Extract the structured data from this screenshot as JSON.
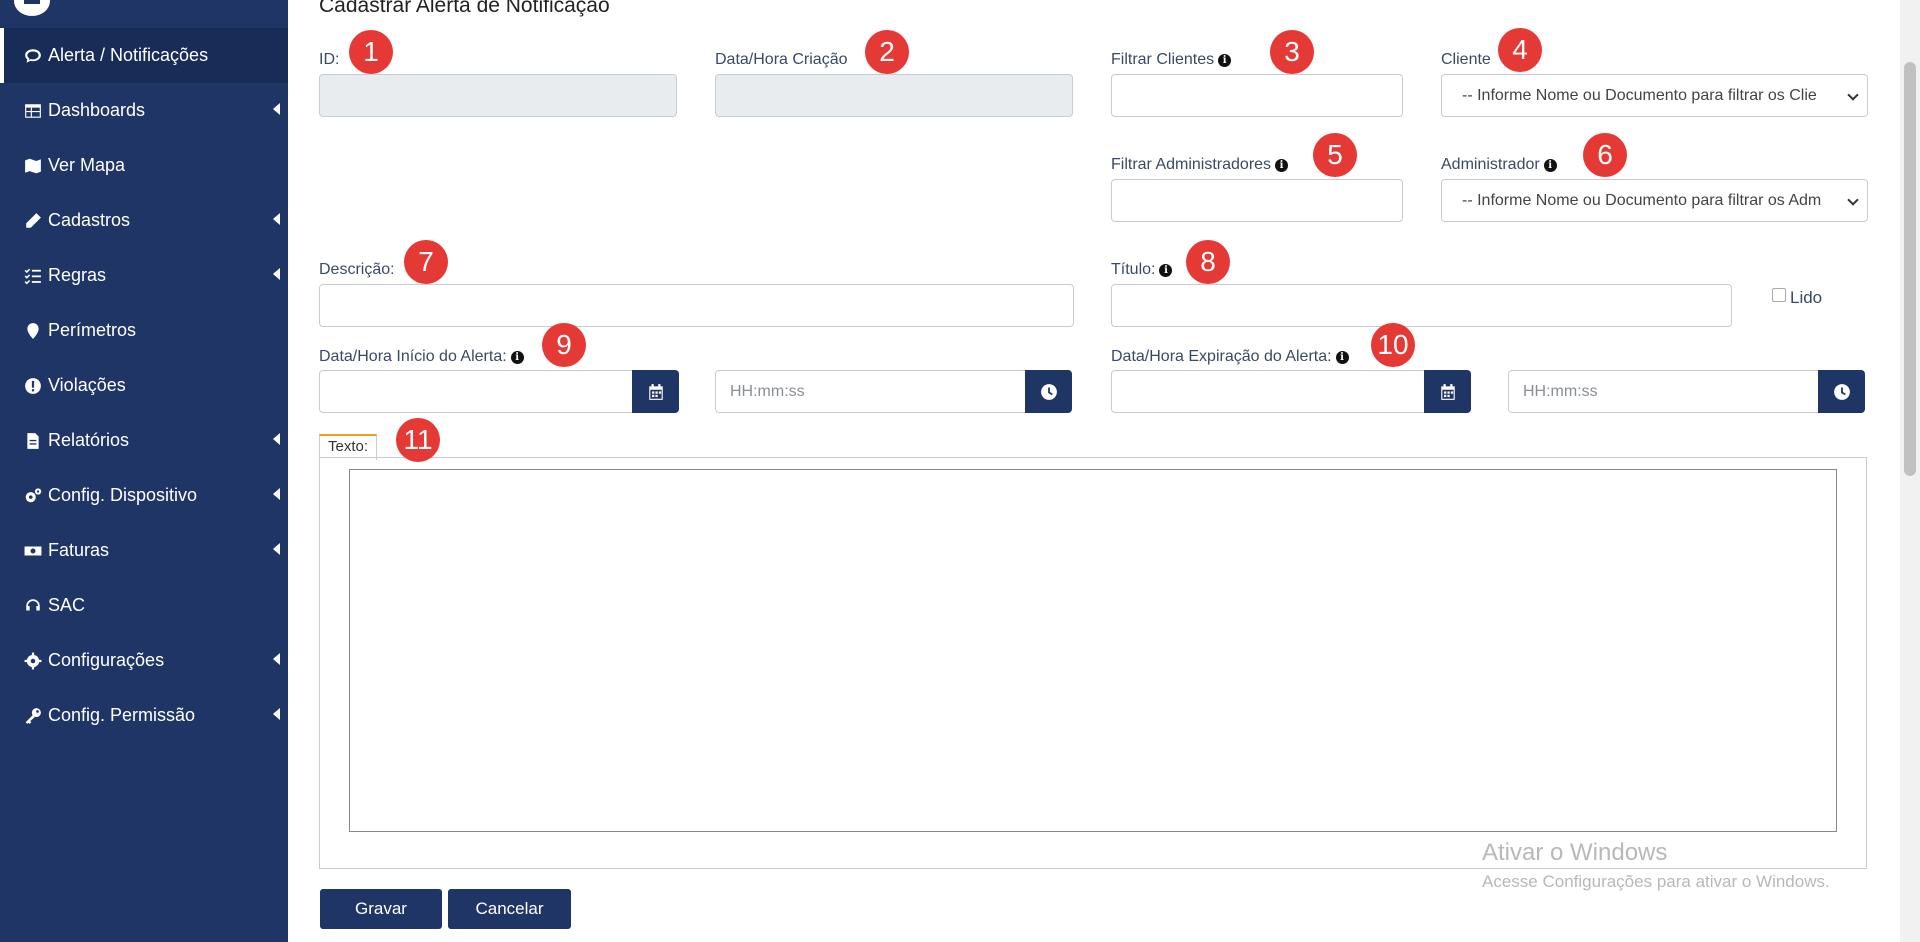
{
  "sidebar": {
    "items": [
      {
        "label": "Alerta / Notificações",
        "icon": "comment-icon",
        "active": true
      },
      {
        "label": "Dashboards",
        "icon": "table-icon",
        "submenu": true
      },
      {
        "label": "Ver Mapa",
        "icon": "map-icon"
      },
      {
        "label": "Cadastros",
        "icon": "pencil-icon",
        "submenu": true
      },
      {
        "label": "Regras",
        "icon": "list-check-icon",
        "submenu": true
      },
      {
        "label": "Perímetros",
        "icon": "map-marker-icon"
      },
      {
        "label": "Violações",
        "icon": "exclamation-circle-icon"
      },
      {
        "label": "Relatórios",
        "icon": "file-icon",
        "submenu": true
      },
      {
        "label": "Config. Dispositivo",
        "icon": "cogs-icon",
        "submenu": true
      },
      {
        "label": "Faturas",
        "icon": "money-bill-icon",
        "submenu": true
      },
      {
        "label": "SAC",
        "icon": "headset-icon"
      },
      {
        "label": "Configurações",
        "icon": "gear-icon",
        "submenu": true
      },
      {
        "label": "Config. Permissão",
        "icon": "key-icon",
        "submenu": true
      }
    ]
  },
  "page": {
    "title": "Cadastrar Alerta de Notificação"
  },
  "form": {
    "id_label": "ID:",
    "created_label": "Data/Hora Criação",
    "filter_clients_label": "Filtrar Clientes",
    "client_label": "Cliente",
    "client_select": "-- Informe Nome ou Documento para filtrar os Clie",
    "filter_admins_label": "Filtrar Administradores",
    "admin_label": "Administrador",
    "admin_select": "-- Informe Nome ou Documento para filtrar os Adm",
    "description_label": "Descrição:",
    "title_label": "Título:",
    "read_label": "Lido",
    "start_label": "Data/Hora Início do Alerta:",
    "expire_label": "Data/Hora Expiração do Alerta:",
    "time_placeholder": "HH:mm:ss",
    "text_tab": "Texto:"
  },
  "badges": [
    "1",
    "2",
    "3",
    "4",
    "5",
    "6",
    "7",
    "8",
    "9",
    "10",
    "11"
  ],
  "buttons": {
    "save": "Gravar",
    "cancel": "Cancelar"
  },
  "watermark": {
    "line1": "Ativar o Windows",
    "line2": "Acesse Configurações para ativar o Windows."
  },
  "colors": {
    "sidebar": "#1f3566",
    "badge": "#e53935",
    "accent": "#1f3566"
  }
}
